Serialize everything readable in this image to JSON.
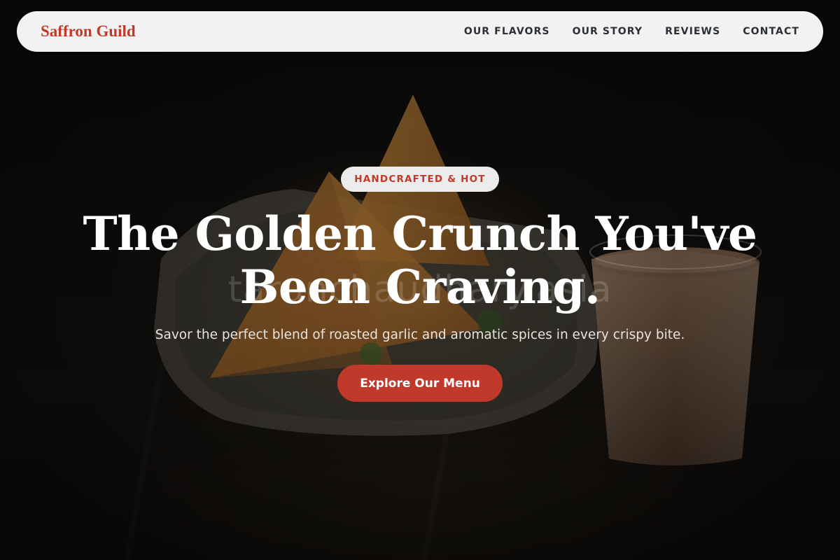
{
  "navbar": {
    "brand": "Saffron Guild",
    "links": [
      {
        "label": "OUR FLAVORS"
      },
      {
        "label": "OUR STORY"
      },
      {
        "label": "REVIEWS"
      },
      {
        "label": "CONTACT"
      }
    ]
  },
  "hero": {
    "badge": "HANDCRAFTED & HOT",
    "headline_line1": "The Golden Crunch You've",
    "headline_line2": "Been Craving.",
    "subtitle": "Savor the perfect blend of roasted garlic and aromatic spices in every crispy bite.",
    "cta_label": "Explore Our Menu",
    "watermark": "tarunchaudhary.asia",
    "image_subject": "samosas-with-chai-photo"
  },
  "colors": {
    "accent": "#c0392b",
    "navbar_bg": "#f2f2f2",
    "nav_text": "#2b2f36",
    "headline_text": "#ffffff",
    "badge_bg": "#ececec"
  }
}
